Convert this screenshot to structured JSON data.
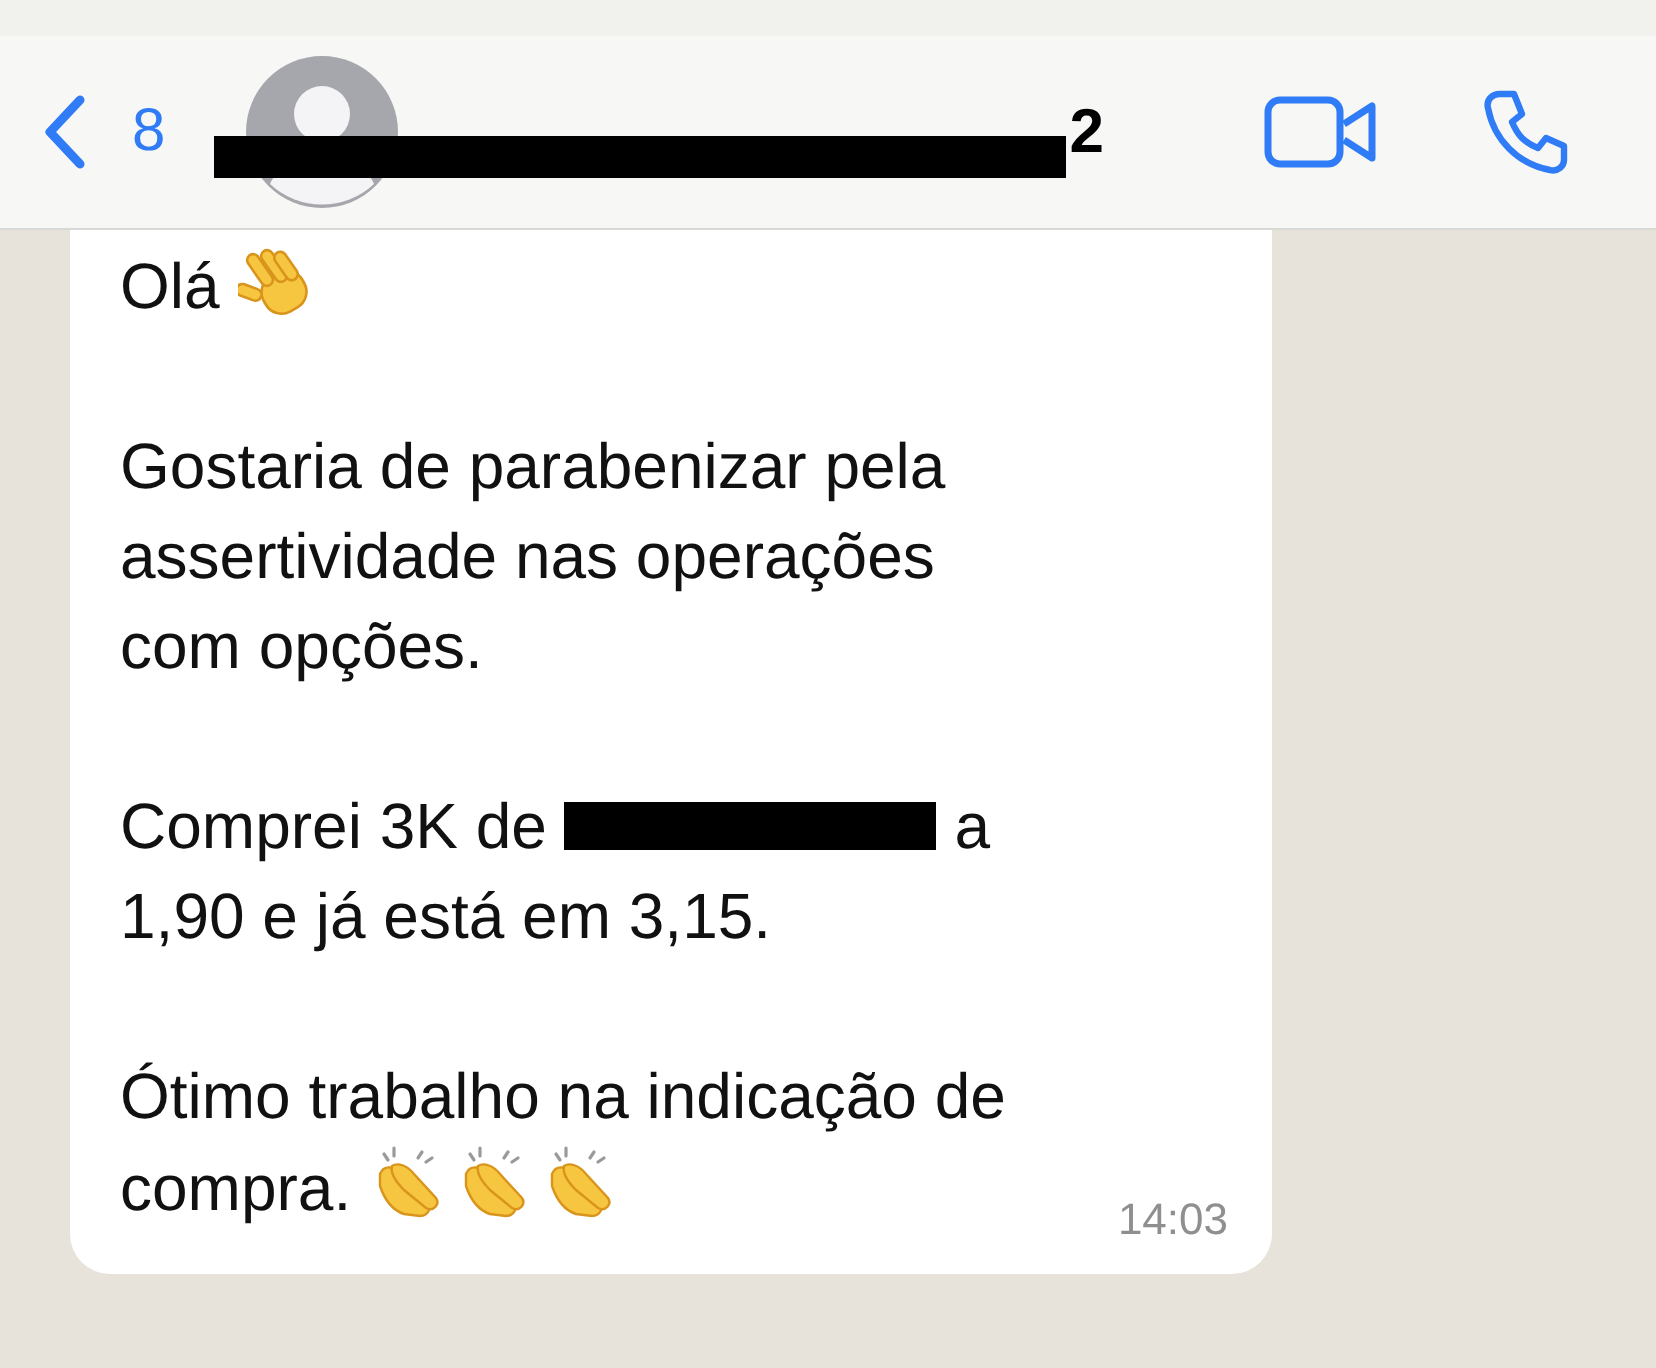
{
  "header": {
    "back_label": "8",
    "contact_name": "2"
  },
  "message": {
    "paragraphs": [
      [
        [
          {
            "kind": "text",
            "text": "Olá"
          },
          {
            "kind": "wave"
          }
        ]
      ],
      [
        [
          {
            "kind": "text",
            "text": "Gostaria de parabenizar pela"
          }
        ],
        [
          {
            "kind": "text",
            "text": "assertividade nas operações"
          }
        ],
        [
          {
            "kind": "text",
            "text": "com opções."
          }
        ]
      ],
      [
        [
          {
            "kind": "text",
            "text": "Comprei 3K de"
          },
          {
            "kind": "redacted"
          },
          {
            "kind": "text",
            "text": "a"
          }
        ],
        [
          {
            "kind": "text",
            "text": "1,90 e já está em 3,15."
          }
        ]
      ],
      [
        [
          {
            "kind": "text",
            "text": "Ótimo trabalho na indicação de"
          }
        ],
        [
          {
            "kind": "text",
            "text": "compra."
          },
          {
            "kind": "clap"
          },
          {
            "kind": "clap"
          },
          {
            "kind": "clap"
          }
        ]
      ]
    ],
    "time": "14:03"
  }
}
